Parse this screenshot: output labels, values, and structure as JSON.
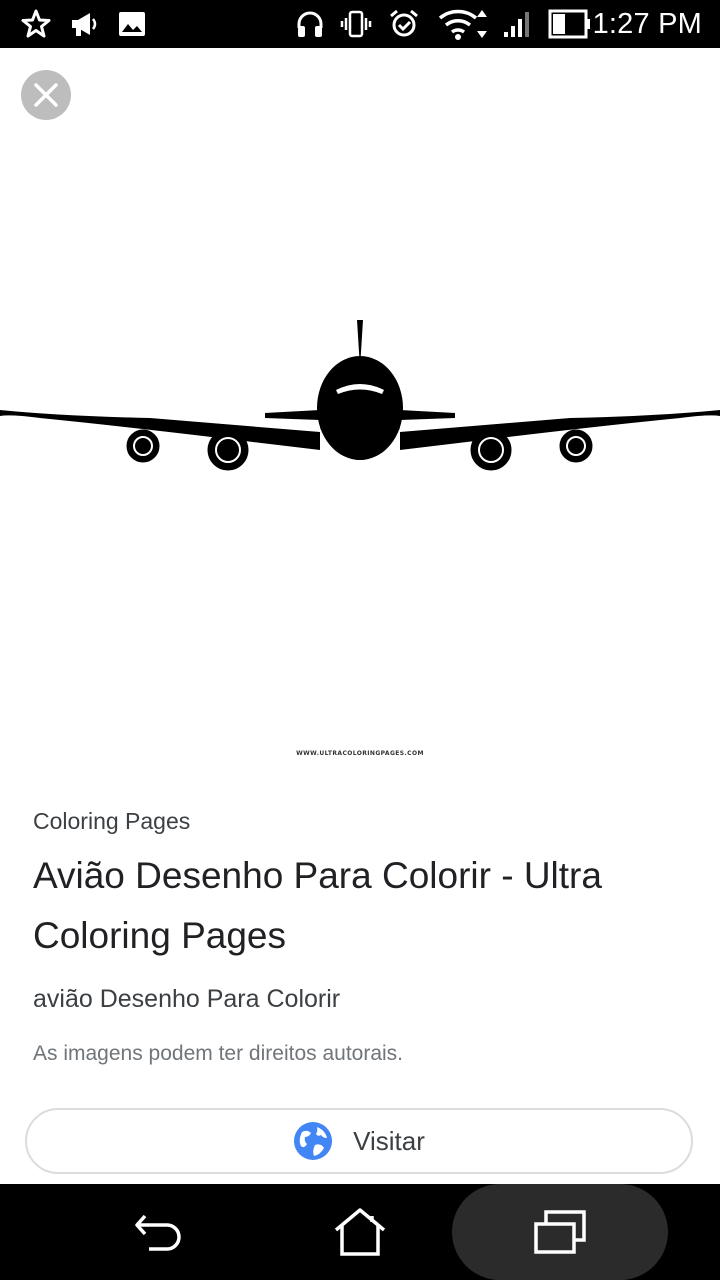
{
  "status_bar": {
    "time": "1:27 PM",
    "left_icons": [
      "star-icon",
      "megaphone-icon",
      "image-icon"
    ],
    "right_icons": [
      "headphones-icon",
      "vibrate-icon",
      "alarm-icon",
      "wifi-icon",
      "signal-icon",
      "battery-icon"
    ]
  },
  "viewer": {
    "close_icon": "close-icon",
    "image_subject": "airplane front view silhouette",
    "watermark": "WWW.ULTRACOLORINGPAGES.COM"
  },
  "result": {
    "source": "Coloring Pages",
    "title": "Avião Desenho Para Colorir - Ultra Coloring Pages",
    "subtitle": "avião Desenho Para Colorir",
    "copyright_notice": "As imagens podem ter direitos autorais.",
    "visit_label": "Visitar"
  },
  "nav_bar": {
    "back_icon": "back-icon",
    "home_icon": "home-icon",
    "recents_icon": "recents-icon"
  },
  "colors": {
    "globe_blue": "#4285f4",
    "close_bg": "#bdbdbd"
  }
}
